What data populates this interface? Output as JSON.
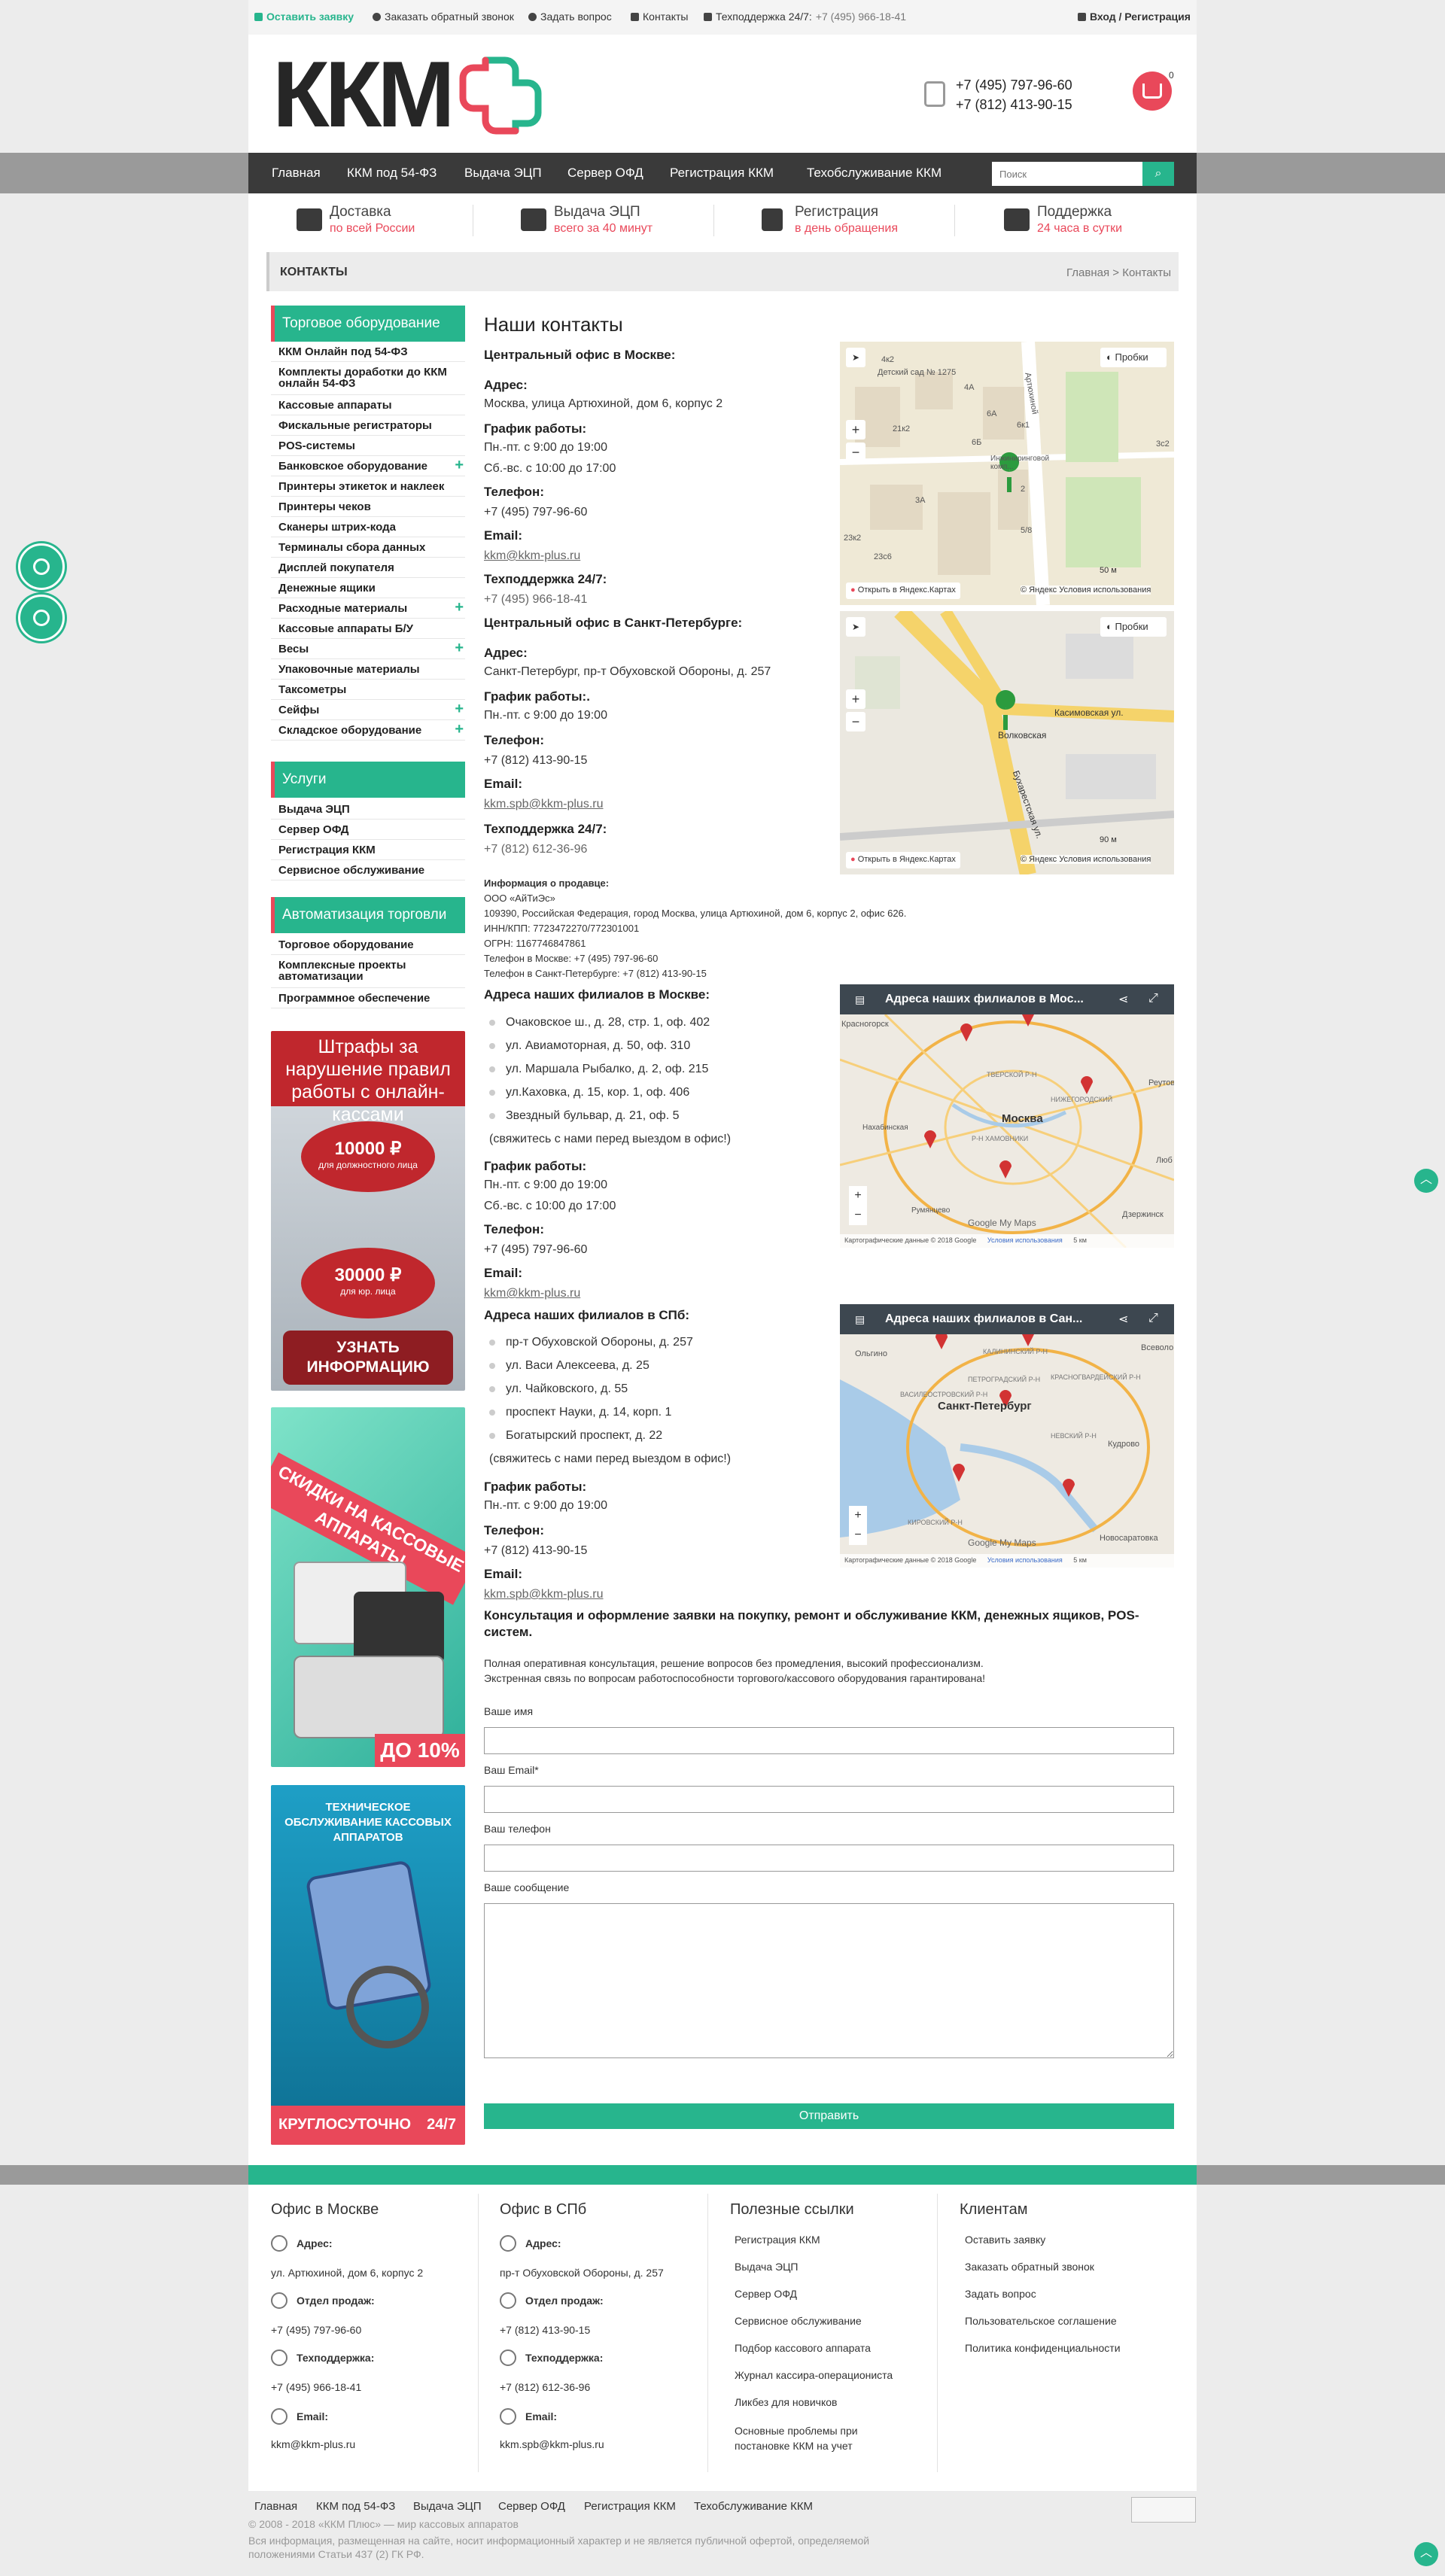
{
  "topbar": {
    "request": "Оставить заявку",
    "callback": "Заказать обратный звонок",
    "question": "Задать вопрос",
    "contacts": "Контакты",
    "support_label": "Техподдержка 24/7:",
    "support_phone": "+7 (495) 966-18-41",
    "auth": "Вход / Регистрация"
  },
  "header": {
    "logo_text": "ККМ",
    "phone1": "+7 (495) 797-96-60",
    "phone2": "+7 (812) 413-90-15",
    "cart_count": "0"
  },
  "nav": {
    "items": [
      "Главная",
      "ККМ под 54-ФЗ",
      "Выдача ЭЦП",
      "Сервер ОФД",
      "Регистрация ККМ",
      "Техобслуживание ККМ"
    ],
    "search_placeholder": "Поиск"
  },
  "features": [
    {
      "title": "Доставка",
      "sub": "по всей России",
      "icon": "truck-icon"
    },
    {
      "title": "Выдача ЭЦП",
      "sub": "всего за 40 минут",
      "icon": "exchange-icon"
    },
    {
      "title": "Регистрация",
      "sub": "в день обращения",
      "icon": "document-icon"
    },
    {
      "title": "Поддержка",
      "sub": "24 часа в сутки",
      "icon": "gears-icon"
    }
  ],
  "breadcrumb": {
    "title": "КОНТАКТЫ",
    "path": "Главная > Контакты"
  },
  "sidebar": {
    "sec1": "Торговое оборудование",
    "items1": [
      "ККМ Онлайн под 54-ФЗ",
      "Комплекты доработки до ККМ онлайн 54-ФЗ",
      "Кассовые аппараты",
      "Фискальные регистраторы",
      "POS-системы",
      "Банковское оборудование",
      "Принтеры этикеток и наклеек",
      "Принтеры чеков",
      "Сканеры штрих-кода",
      "Терминалы сбора данных",
      "Дисплей покупателя",
      "Денежные ящики",
      "Расходные материалы",
      "Кассовые аппараты Б/У",
      "Весы",
      "Упаковочные материалы",
      "Таксометры",
      "Сейфы",
      "Складское оборудование"
    ],
    "sec2": "Услуги",
    "items2": [
      "Выдача ЭЦП",
      "Сервер ОФД",
      "Регистрация ККМ",
      "Сервисное обслуживание"
    ],
    "sec3": "Автоматизация торговли",
    "items3": [
      "Торговое оборудование",
      "Комплексные проекты автоматизации",
      "Программное обеспечение"
    ]
  },
  "banners": {
    "b1_title": "Штрафы за нарушение правил работы с онлайн-кассами",
    "b1_v1": "10000 ₽",
    "b1_v1_sub": "для должностного лица",
    "b1_v2": "30000 ₽",
    "b1_v2_sub": "для юр. лица",
    "b1_btn": "УЗНАТЬ ИНФОРМАЦИЮ",
    "b2_title": "СКИДКИ НА КАССОВЫЕ АППАРАТЫ",
    "b2_disc": "ДО 10%",
    "b3_title": "ТЕХНИЧЕСКОЕ ОБСЛУЖИВАНИЕ КАССОВЫХ АППАРАТОВ",
    "b3_bottom": "КРУГЛОСУТОЧНО",
    "b3_tag": "24/7"
  },
  "content": {
    "title": "Наши контакты",
    "msk_office": "Центральный офис в Москве:",
    "address_label": "Адрес:",
    "msk_address": "Москва, улица Артюхиной, дом 6, корпус 2",
    "schedule_label": "График работы:",
    "schedule_label_spb": "График работы:.",
    "sched_weekdays": "Пн.-пт. с 9:00 до 19:00",
    "sched_sat": "Сб.-вс. с 10:00 до 17:00",
    "phone_label": "Телефон:",
    "msk_phone": "+7 (495) 797-96-60",
    "email_label": "Email:",
    "msk_email": "kkm@kkm-plus.ru",
    "support_label": "Техподдержка 24/7:",
    "msk_support": "+7 (495) 966-18-41",
    "spb_office": "Центральный офис в Санкт-Петербурге:",
    "spb_address": "Санкт-Петербург, пр-т Обуховской Обороны, д. 257",
    "spb_phone": "+7 (812) 413-90-15",
    "spb_email": "kkm.spb@kkm-plus.ru",
    "spb_support": "+7 (812) 612-36-96",
    "seller_title": "Информация о продавце:",
    "seller_lines": [
      "ООО «АйТиЭс»",
      "109390, Российская Федерация, город Москва, улица Артюхиной, дом 6, корпус 2, офис 626.",
      "ИНН/КПП: 7723472270/772301001",
      "ОГРН: 1167746847861",
      "Телефон в Москве: +7 (495) 797-96-60",
      "Телефон в Санкт-Петербурге: +7 (812) 413-90-15"
    ],
    "msk_branches_title": "Адреса наших филиалов в Москве:",
    "msk_branches": [
      "Очаковское ш., д. 28, стр. 1, оф. 402",
      "ул. Авиамоторная, д. 50, оф. 310",
      "ул. Маршала Рыбалко, д. 2, оф. 215",
      "ул.Каховка, д. 15, кор. 1, оф. 406",
      "Звездный бульвар, д. 21, оф. 5"
    ],
    "call_note": "(свяжитесь с нами перед выездом в офис!)",
    "spb_branches_title": "Адреса наших филиалов в СПб:",
    "spb_branches": [
      "пр-т Обуховской Обороны, д. 257",
      "ул. Васи Алексеева, д. 25",
      "ул. Чайковского, д. 55",
      "проспект Науки, д. 14, корп. 1",
      "Богатырский проспект, д. 22"
    ],
    "consult_title": "Консультация и оформление заявки на покупку, ремонт и обслуживание ККМ, денежных ящиков, POS-систем.",
    "consult_text1": "Полная оперативная консультация, решение вопросов без промедления, высокий профессионализм.",
    "consult_text2": "Экстренная связь по вопросам работоспособности торгового/кассового оборудования гарантирована!"
  },
  "maps": {
    "yandex_open": "Открыть в Яндекс.Картах",
    "yandex_terms": "© Яндекс Условия использования",
    "traffic": "Пробки",
    "scale1": "50 м",
    "scale2": "90 м",
    "ym1_labels": [
      "Детский сад № 1275",
      "4к2",
      "4А",
      "6А",
      "6к1",
      "21к2",
      "6Б",
      "Инжиниринговой комп...",
      "3А",
      "5/8",
      "23к2",
      "23с6",
      "3с2",
      "Артюхиной",
      "2"
    ],
    "ym2_labels": [
      "Касимовская ул.",
      "Волковская",
      "Бухарестская ул."
    ],
    "gmap1_title": "Адреса наших филиалов в Мос...",
    "gmap2_title": "Адреса наших филиалов в Сан...",
    "gmap1_labels": [
      "Москва",
      "Красногорск",
      "Реутов",
      "Люб",
      "Дзержинск",
      "ТВЕРСКОЙ Р-Н",
      "НИЖЕГОРОДСКИЙ",
      "Р-Н ХАМОВНИКИ",
      "Нахабинская",
      "Румянцево"
    ],
    "gmap2_labels": [
      "Санкт-Петербург",
      "Всеволо",
      "Ольгино",
      "КАЛИНИНСКИЙ Р-Н",
      "КРАСНОГВАРДЕЙСКИЙ Р-Н",
      "ПЕТРОГРАДСКИЙ Р-Н",
      "ВАСИЛЕОСТРОВСКИЙ Р-Н",
      "НЕВСКИЙ Р-Н",
      "Кудрово",
      "КИРОВСКИЙ Р-Н",
      "Новосаратовка"
    ],
    "google": "Google My Maps",
    "g_copy": "Картографические данные © 2018 Google",
    "g_terms": "Условия использования",
    "g_scale": "5 км"
  },
  "form": {
    "name_label": "Ваше имя",
    "email_label": "Ваш Email*",
    "phone_label": "Ваш телефон",
    "message_label": "Ваше сообщение",
    "submit": "Отправить"
  },
  "footer": {
    "col1_title": "Офис в Москве",
    "col2_title": "Офис в СПб",
    "col3_title": "Полезные ссылки",
    "col4_title": "Клиентам",
    "address_label": "Адрес:",
    "sales_label": "Отдел продаж:",
    "support_label": "Техподдержка:",
    "email_label": "Email:",
    "msk_address": "ул. Артюхиной, дом 6, корпус 2",
    "msk_sales": "+7 (495) 797-96-60",
    "msk_support": "+7 (495) 966-18-41",
    "msk_email": "kkm@kkm-plus.ru",
    "spb_address": "пр-т Обуховской Обороны, д. 257",
    "spb_sales": "+7 (812) 413-90-15",
    "spb_support": "+7 (812) 612-36-96",
    "spb_email": "kkm.spb@kkm-plus.ru",
    "links": [
      "Регистрация ККМ",
      "Выдача ЭЦП",
      "Сервер ОФД",
      "Сервисное обслуживание",
      "Подбор кассового аппарата",
      "Журнал кассира-операциониста",
      "Ликбез для новичков",
      "Основные проблемы при постановке ККМ на учет"
    ],
    "clients": [
      "Оставить заявку",
      "Заказать обратный звонок",
      "Задать вопрос",
      "Пользовательское соглашение",
      "Политика конфиденциальности"
    ],
    "bottom_nav": [
      "Главная",
      "ККМ под 54-ФЗ",
      "Выдача ЭЦП",
      "Сервер ОФД",
      "Регистрация ККМ",
      "Техобслуживание ККМ"
    ],
    "copyright": "© 2008 - 2018 «ККМ Плюс» — мир кассовых аппаратов",
    "disclaimer1": "Вся информация, размещенная на сайте, носит информационный характер и не является публичной офертой, определяемой",
    "disclaimer2": "положениями Статьи 437 (2) ГК РФ."
  },
  "colors": {
    "accent": "#27b58d",
    "brand_red": "#e9485a",
    "nav_bg": "#3a3a3a"
  }
}
